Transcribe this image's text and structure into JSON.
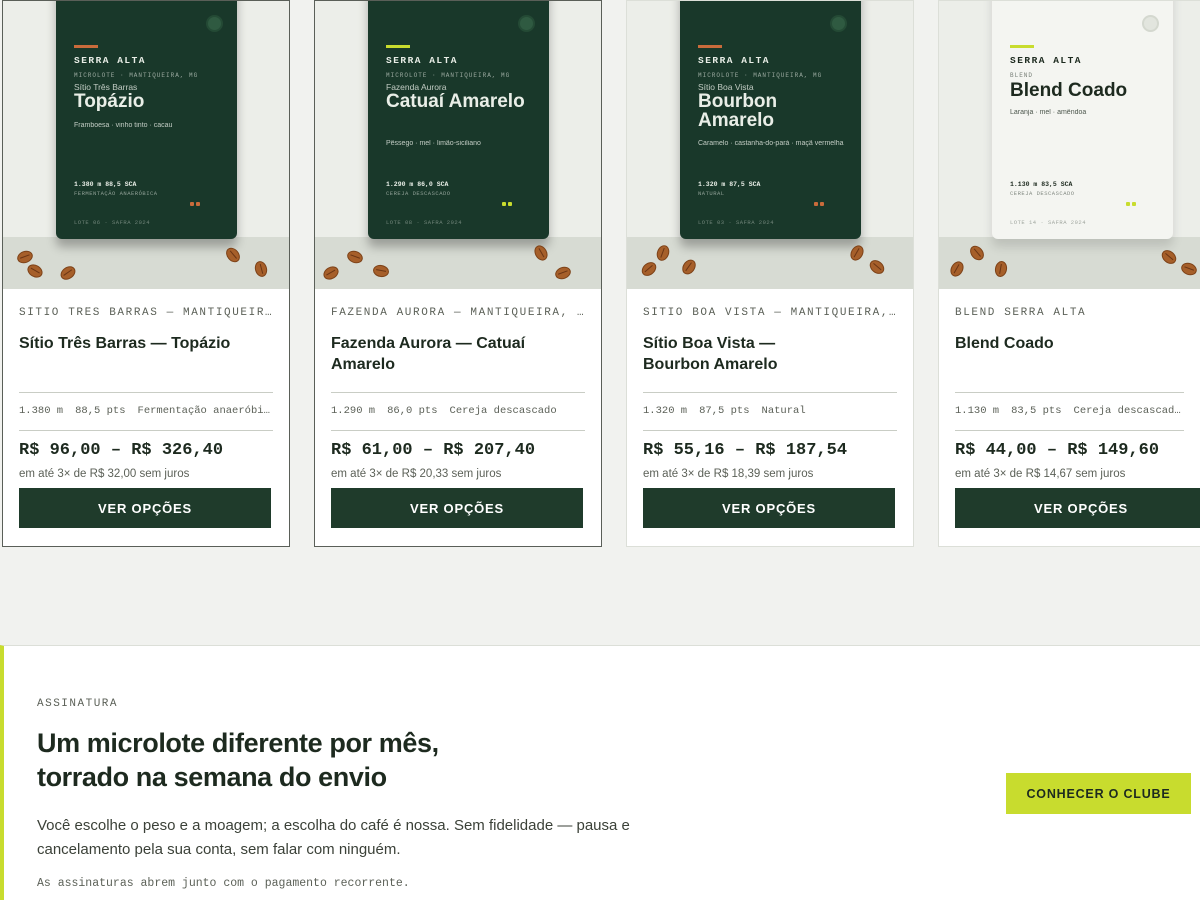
{
  "products": [
    {
      "bag": {
        "brand": "SERRA ALTA",
        "origin": "MICROLOTE · MANTIQUEIRA, MG",
        "farm": "Sítio Três Barras",
        "name": "Topázio",
        "notes": "Framboesa · vinho tinto · cacau",
        "specs": "1.380 m    88,5 SCA",
        "process": "FERMENTAÇÃO ANAERÓBICA",
        "lot": "LOTE 06 · SAFRA 2024",
        "accent": "#c96b3b",
        "variant": "dark"
      },
      "origin_line": "SÍTIO TRÊS BARRAS — MANTIQUEIRA, MG",
      "title": "Sítio Três Barras — Topázio",
      "altitude": "1.380 m",
      "score": "88,5 pts",
      "process": "Fermentação anaeróbica",
      "price": "R$ 96,00 – R$ 326,40",
      "installments": "em até 3× de R$ 32,00 sem juros",
      "button": "VER OPÇÕES"
    },
    {
      "bag": {
        "brand": "SERRA ALTA",
        "origin": "MICROLOTE · MANTIQUEIRA, MG",
        "farm": "Fazenda Aurora",
        "name": "Catuaí Amarelo",
        "notes": "Pêssego · mel · limão-siciliano",
        "specs": "1.290 m    86,0 SCA",
        "process": "CEREJA DESCASCADO",
        "lot": "LOTE 08 · SAFRA 2024",
        "accent": "#c8dc2e",
        "variant": "dark"
      },
      "origin_line": "FAZENDA AURORA — MANTIQUEIRA, MG",
      "title": "Fazenda Aurora — Catuaí Amarelo",
      "altitude": "1.290 m",
      "score": "86,0 pts",
      "process": "Cereja descascado",
      "price": "R$ 61,00 – R$ 207,40",
      "installments": "em até 3× de R$ 20,33 sem juros",
      "button": "VER OPÇÕES"
    },
    {
      "bag": {
        "brand": "SERRA ALTA",
        "origin": "MICROLOTE · MANTIQUEIRA, MG",
        "farm": "Sítio Boa Vista",
        "name": "Bourbon Amarelo",
        "notes": "Caramelo · castanha-do-pará · maçã vermelha",
        "specs": "1.320 m    87,5 SCA",
        "process": "NATURAL",
        "lot": "LOTE 03 · SAFRA 2024",
        "accent": "#c96b3b",
        "variant": "dark"
      },
      "origin_line": "SÍTIO BOA VISTA — MANTIQUEIRA, MG",
      "title": "Sítio Boa Vista — Bourbon Amarelo",
      "altitude": "1.320 m",
      "score": "87,5 pts",
      "process": "Natural",
      "price": "R$ 55,16 – R$ 187,54",
      "installments": "em até 3× de R$ 18,39 sem juros",
      "button": "VER OPÇÕES"
    },
    {
      "bag": {
        "brand": "SERRA ALTA",
        "origin": "BLEND",
        "farm": "",
        "name": "Blend Coado",
        "notes": "Laranja · mel · amêndoa",
        "specs": "1.130 m    83,5 SCA",
        "process": "CEREJA DESCASCADO",
        "lot": "LOTE 14 · SAFRA 2024",
        "accent": "#c8dc2e",
        "variant": "light"
      },
      "origin_line": "BLEND SERRA ALTA",
      "title": "Blend Coado",
      "altitude": "1.130 m",
      "score": "83,5 pts",
      "process": "Cereja descascado",
      "price": "R$ 44,00 – R$ 149,60",
      "installments": "em até 3× de R$ 14,67 sem juros",
      "button": "VER OPÇÕES"
    }
  ],
  "subscription": {
    "eyebrow": "ASSINATURA",
    "heading_line1": "Um microlote diferente por mês,",
    "heading_line2": "torrado na semana do envio",
    "body": "Você escolhe o peso e a moagem; a escolha do café é nossa. Sem fidelidade — pausa e cancelamento pela sua conta, sem falar com ninguém.",
    "note": "As assinaturas abrem junto com o pagamento recorrente.",
    "cta": "CONHECER O CLUBE"
  },
  "colors": {
    "bag_dark": "#19382a",
    "button": "#1f3b2b",
    "accent_lime": "#c8dc2e",
    "accent_copper": "#c96b3b"
  }
}
